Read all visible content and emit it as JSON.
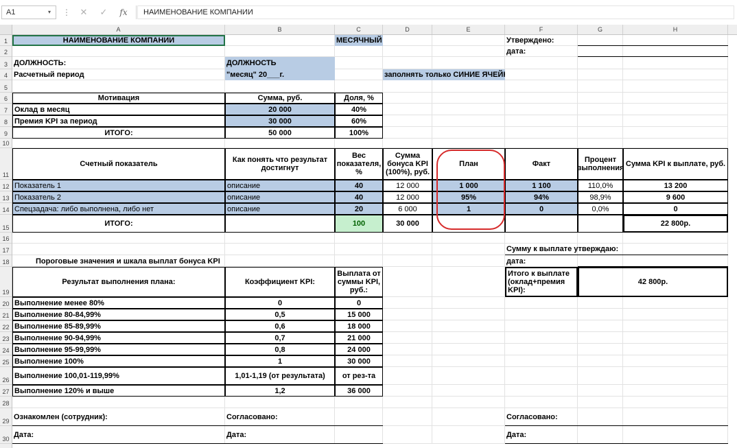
{
  "formula_bar": {
    "name_box": "A1",
    "name_box_arrow": "▾",
    "dots": "⋮",
    "cancel_icon": "✕",
    "confirm_icon": "✓",
    "fx_label": "fx",
    "formula_text": "НАИМЕНОВАНИЕ КОМПАНИИ"
  },
  "columns": [
    "A",
    "B",
    "C",
    "D",
    "E",
    "F",
    "G",
    "H"
  ],
  "rows": [
    "1",
    "2",
    "3",
    "4",
    "5",
    "6",
    "7",
    "8",
    "9",
    "10",
    "11",
    "12",
    "13",
    "14",
    "15",
    "16",
    "17",
    "18",
    "19",
    "20",
    "21",
    "22",
    "23",
    "24",
    "25",
    "26",
    "27",
    "28",
    "29",
    "30"
  ],
  "header": {
    "company": "НАИМЕНОВАНИЕ КОМПАНИИ",
    "monthly_kpi": "МЕСЯЧНЫЙ KPI",
    "approved": "Утверждено:",
    "date_label": "дата:",
    "position_label": "ДОЛЖНОСТЬ:",
    "position_value": "ДОЛЖНОСТЬ",
    "period_label": "Расчетный период",
    "period_value": "\"месяц\" 20___г.",
    "fill_note": "заполнять только СИНИЕ ЯЧЕЙКИ"
  },
  "motivation": {
    "headers": [
      "Мотивация",
      "Сумма, руб.",
      "Доля, %"
    ],
    "rows": [
      [
        "Оклад в месяц",
        "20 000",
        "40%"
      ],
      [
        "Премия KPI за период",
        "30 000",
        "60%"
      ]
    ],
    "total": [
      "ИТОГО:",
      "50 000",
      "100%"
    ]
  },
  "kpi_table": {
    "headers": [
      "Счетный показатель",
      "Как понять что результат достигнут",
      "Вес показателя, %",
      "Сумма бонуса KPI (100%), руб.",
      "План",
      "Факт",
      "Процент выполнения",
      "Сумма KPI к выплате, руб."
    ],
    "rows": [
      [
        "Показатель 1",
        "описание",
        "40",
        "12 000",
        "1 000",
        "1 100",
        "110,0%",
        "13 200"
      ],
      [
        "Показатель 2",
        "описание",
        "40",
        "12 000",
        "95%",
        "94%",
        "98,9%",
        "9 600"
      ],
      [
        "Спецзадача: либо выполнена, либо нет",
        "описание",
        "20",
        "6 000",
        "1",
        "0",
        "0,0%",
        "0"
      ]
    ],
    "total_label": "ИТОГО:",
    "total_weight": "100",
    "total_bonus": "30 000",
    "total_payout": "22 800р."
  },
  "approval": {
    "sum_approve": "Сумму к выплате утверждаю:",
    "date_label": "дата:",
    "total_label": "Итого к выплате (оклад+премия KPI):",
    "total_value": "42 800р."
  },
  "thresholds": {
    "title": "Пороговые значения и шкала выплат бонуса KPI",
    "headers": [
      "Результат выполнения плана:",
      "Коэффициент KPI:",
      "Выплата от суммы KPI, руб.:"
    ],
    "rows": [
      [
        "Выполнение менее 80%",
        "0",
        "0"
      ],
      [
        "Выполнение 80-84,99%",
        "0,5",
        "15 000"
      ],
      [
        "Выполнение 85-89,99%",
        "0,6",
        "18 000"
      ],
      [
        "Выполнение 90-94,99%",
        "0,7",
        "21 000"
      ],
      [
        "Выполнение 95-99,99%",
        "0,8",
        "24 000"
      ],
      [
        "Выполнение 100%",
        "1",
        "30 000"
      ],
      [
        "Выполнение 100,01-119,99%",
        "1,01-1,19 (от результата)",
        "от рез-та"
      ],
      [
        "Выполнение 120% и выше",
        "1,2",
        "36 000"
      ]
    ]
  },
  "signatures": {
    "employee": "Ознакомлен (сотрудник):",
    "agreed": "Согласовано:",
    "date": "Дата:"
  },
  "colors": {
    "input_blue": "#b8cce4",
    "total_green": "#c6efce",
    "annotation_red": "#d62a2a",
    "selection": "#217346"
  }
}
